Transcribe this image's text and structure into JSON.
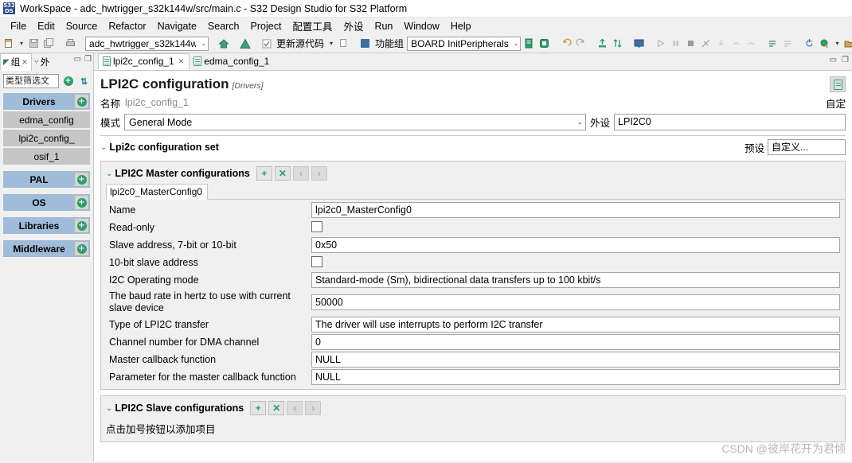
{
  "window": {
    "title": "WorkSpace - adc_hwtrigger_s32k144w/src/main.c - S32 Design Studio for S32 Platform",
    "logo_top": "532",
    "logo_bottom": "DS"
  },
  "menubar": {
    "items": [
      "File",
      "Edit",
      "Source",
      "Refactor",
      "Navigate",
      "Search",
      "Project",
      "配置工具",
      "外设",
      "Run",
      "Window",
      "Help"
    ]
  },
  "toolbar": {
    "project_combo": "adc_hwtrigger_s32k144w",
    "update_source_label": "更新源代码",
    "function_group_label": "功能组",
    "board_combo": "BOARD  InitPeripherals",
    "caret": "▾"
  },
  "left_panel": {
    "tabs": [
      {
        "label": "组",
        "icon": "components-icon",
        "active": true,
        "closable": true
      },
      {
        "label": "外",
        "icon": "peripherals-icon",
        "active": false,
        "closable": false
      }
    ],
    "minimize": "▭",
    "maximize": "❐",
    "filter_placeholder": "类型筛选文",
    "add_icon": "plus-circle-icon",
    "sort_icon": "sort-icon",
    "groups": [
      {
        "name": "Drivers",
        "type": "group",
        "has_add": true
      },
      {
        "name": "edma_config",
        "type": "child"
      },
      {
        "name": "lpi2c_config_",
        "type": "child"
      },
      {
        "name": "osif_1",
        "type": "child"
      },
      {
        "name": "PAL",
        "type": "group",
        "has_add": true
      },
      {
        "name": "OS",
        "type": "group",
        "has_add": true
      },
      {
        "name": "Libraries",
        "type": "group",
        "has_add": true
      },
      {
        "name": "Middleware",
        "type": "group",
        "has_add": true
      }
    ]
  },
  "editor": {
    "tabs": [
      {
        "label": "lpi2c_config_1",
        "active": true,
        "closable": true
      },
      {
        "label": "edma_config_1",
        "active": false,
        "closable": false
      }
    ],
    "minimize": "▭",
    "maximize": "❐",
    "header": {
      "title": "LPI2C configuration",
      "subtitle": "[Drivers]",
      "doc_button_icon": "document-icon"
    },
    "name_row": {
      "label": "名称",
      "value": "lpi2c_config_1",
      "custom_label": "自定"
    },
    "mode_row": {
      "label": "模式",
      "value": "General Mode",
      "peripheral_label": "外设",
      "peripheral_value": "LPI2C0",
      "arrow": "⌄"
    },
    "config_set": {
      "title": "Lpi2c configuration set",
      "twisty": "⌄",
      "preset_label": "预设",
      "preset_value": "自定义..."
    },
    "master": {
      "title": "LPI2C Master configurations",
      "twisty": "⌄",
      "buttons": [
        {
          "name": "add",
          "glyph": "+",
          "enabled": true
        },
        {
          "name": "remove",
          "glyph": "✕",
          "enabled": true
        },
        {
          "name": "prev",
          "glyph": "‹",
          "enabled": false
        },
        {
          "name": "next",
          "glyph": "›",
          "enabled": false
        }
      ],
      "subtab": "lpi2c0_MasterConfig0",
      "fields": [
        {
          "label": "Name",
          "type": "text",
          "value": "lpi2c0_MasterConfig0"
        },
        {
          "label": "Read-only",
          "type": "checkbox",
          "checked": false
        },
        {
          "label": "Slave address, 7-bit or 10-bit",
          "type": "text",
          "value": "0x50"
        },
        {
          "label": "10-bit slave address",
          "type": "checkbox",
          "checked": false
        },
        {
          "label": "I2C Operating mode",
          "type": "text",
          "value": "Standard-mode (Sm), bidirectional data transfers up to 100 kbit/s"
        },
        {
          "label": "The baud rate in hertz to use with current slave device",
          "type": "text",
          "value": "50000"
        },
        {
          "label": "Type of LPI2C transfer",
          "type": "text",
          "value": "The driver will use interrupts to perform I2C transfer"
        },
        {
          "label": "Channel number for DMA channel",
          "type": "text",
          "value": "0"
        },
        {
          "label": "Master callback function",
          "type": "text",
          "value": "NULL"
        },
        {
          "label": "Parameter for the master callback function",
          "type": "text",
          "value": "NULL"
        }
      ]
    },
    "slave": {
      "title": "LPI2C Slave configurations",
      "twisty": "⌄",
      "buttons": [
        {
          "name": "add",
          "glyph": "+",
          "enabled": true
        },
        {
          "name": "remove",
          "glyph": "✕",
          "enabled": true
        },
        {
          "name": "prev",
          "glyph": "‹",
          "enabled": false
        },
        {
          "name": "next",
          "glyph": "›",
          "enabled": false
        }
      ],
      "empty_message": "点击加号按钮以添加项目"
    }
  },
  "watermark": "CSDN @彼岸花开为君倾",
  "colors": {
    "accent_green": "#2e9e6b",
    "group_blue": "#9fbcd8",
    "child_gray": "#c6c6c6",
    "panel_bg": "#f0f0f0"
  }
}
